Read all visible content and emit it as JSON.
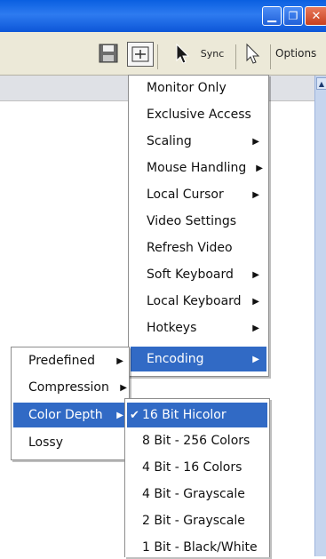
{
  "window": {
    "controls": {
      "minimize_icon": "minimize-icon",
      "restore_icon": "restore-icon",
      "close_icon": "close-icon"
    }
  },
  "toolbar": {
    "sync_label": "Sync",
    "options_label": "Options",
    "icons": [
      "save-icon",
      "fit-window-icon",
      "cursor-icon",
      "cursor-outline-icon"
    ]
  },
  "options_menu": [
    {
      "label": "Monitor Only",
      "submenu": false
    },
    {
      "label": "Exclusive Access",
      "submenu": false
    },
    {
      "label": "Scaling",
      "submenu": true
    },
    {
      "label": "Mouse Handling",
      "submenu": true
    },
    {
      "label": "Local Cursor",
      "submenu": true
    },
    {
      "label": "Video Settings",
      "submenu": false
    },
    {
      "label": "Refresh Video",
      "submenu": false
    },
    {
      "label": "Soft Keyboard",
      "submenu": true
    },
    {
      "label": "Local Keyboard",
      "submenu": true
    },
    {
      "label": "Hotkeys",
      "submenu": true
    },
    {
      "label": "Encoding",
      "submenu": true,
      "highlighted": true
    }
  ],
  "encoding_menu": [
    {
      "label": "Predefined",
      "submenu": true
    },
    {
      "label": "Compression",
      "submenu": true
    },
    {
      "label": "Color Depth",
      "submenu": true,
      "highlighted": true
    },
    {
      "label": "Lossy",
      "submenu": false
    }
  ],
  "color_depth_menu": [
    {
      "label": "16 Bit Hicolor",
      "checked": true,
      "highlighted": true
    },
    {
      "label": "8 Bit - 256 Colors"
    },
    {
      "label": "4 Bit - 16 Colors"
    },
    {
      "label": "4 Bit - Grayscale"
    },
    {
      "label": "2 Bit - Grayscale"
    },
    {
      "label": "1 Bit - Black/White"
    }
  ],
  "colors": {
    "titlebar": "#2e7bf0",
    "highlight": "#316ac5",
    "toolbar": "#ece9d8",
    "close_button": "#c8401e"
  }
}
